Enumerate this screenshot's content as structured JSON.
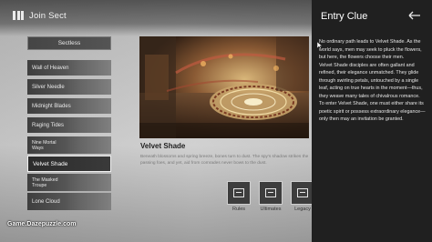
{
  "header": {
    "title": "Join Sect"
  },
  "sect_list": {
    "top_item": "Sectless",
    "items": [
      {
        "label": "Wall of Heaven",
        "active": false
      },
      {
        "label": "Silver Needle",
        "active": false
      },
      {
        "label": "Midnight Blades",
        "active": false
      },
      {
        "label": "Raging Tides",
        "active": false
      },
      {
        "label": "Nine Mortal Ways",
        "active": false
      },
      {
        "label": "Velvet Shade",
        "active": true
      },
      {
        "label": "The Masked Troupe",
        "active": false
      },
      {
        "label": "Lone Cloud",
        "active": false
      }
    ]
  },
  "selected_sect": {
    "name": "Velvet Shade",
    "description": "Beneath blossoms and spring breeze, bones turn to dust. The spy's shadow strikes the passing foes, and yet, aid from comrades never bows to the dust."
  },
  "actions": [
    {
      "label": "Rules",
      "icon": "rules-icon"
    },
    {
      "label": "Ultimates",
      "icon": "ultimates-icon"
    },
    {
      "label": "Legacy",
      "icon": "legacy-icon"
    }
  ],
  "watermark": {
    "text": "Game.Dazepuzzle.com"
  },
  "entry_clue": {
    "title": "Entry Clue",
    "paragraphs": [
      "No ordinary path leads to Velvet Shade. As the world says, men may seek to pluck the flowers, but here, the flowers choose their men.",
      "Velvet Shade disciples are often gallant and refined, their elegance unmatched. They glide through swirling petals, untouched by a single leaf, acting on true hearts in the moment—thus, they weave many tales of chivalrous romance.",
      "To enter Velvet Shade, one must either share its poetic spirit or possess extraordinary elegance—only then may an invitation be granted."
    ]
  },
  "colors": {
    "panel_bg": "#202020",
    "active_border": "#f0f0f0",
    "list_item_bg": "#4a4a4a"
  }
}
